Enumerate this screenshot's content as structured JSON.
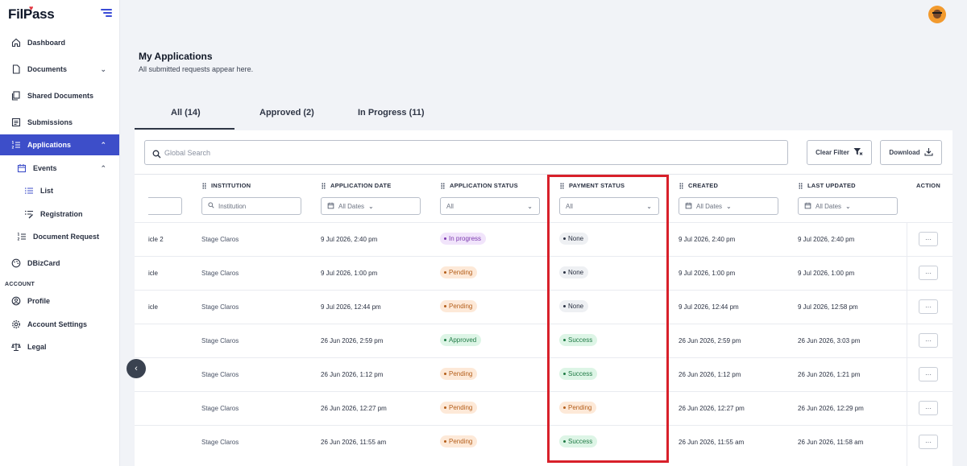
{
  "app": {
    "logo": "FilPass"
  },
  "sidebar": {
    "items": [
      {
        "label": "Dashboard",
        "icon": "home-icon"
      },
      {
        "label": "Documents",
        "icon": "document-icon"
      },
      {
        "label": "Shared Documents",
        "icon": "shared-documents-icon"
      },
      {
        "label": "Submissions",
        "icon": "submissions-icon"
      },
      {
        "label": "Applications",
        "icon": "list-numbered-icon",
        "active": true
      },
      {
        "label": "Events",
        "icon": "calendar-icon"
      },
      {
        "label": "List",
        "icon": "list-icon"
      },
      {
        "label": "Registration",
        "icon": "registration-icon"
      },
      {
        "label": "Document Request",
        "icon": "list-numbered-icon"
      },
      {
        "label": "DBizCard",
        "icon": "palette-icon"
      },
      {
        "label": "Profile",
        "icon": "user-circle-icon"
      },
      {
        "label": "Account Settings",
        "icon": "gear-icon"
      },
      {
        "label": "Legal",
        "icon": "scale-icon"
      }
    ],
    "section_account": "ACCOUNT"
  },
  "header": {
    "title": "My Applications",
    "subtitle": "All submitted requests appear here."
  },
  "tabs": [
    {
      "label": "All (14)",
      "active": true
    },
    {
      "label": "Approved (2)"
    },
    {
      "label": "In Progress (11)"
    }
  ],
  "toolbar": {
    "search_placeholder": "Global Search",
    "clear_filter": "Clear Filter",
    "download": "Download"
  },
  "table": {
    "columns": {
      "institution": "INSTITUTION",
      "application_date": "APPLICATION DATE",
      "application_status": "APPLICATION STATUS",
      "payment_status": "PAYMENT STATUS",
      "created": "CREATED",
      "last_updated": "LAST UPDATED",
      "action": "ACTION"
    },
    "filters": {
      "institution_placeholder": "Institution",
      "application_date": "All Dates",
      "application_status": "All",
      "payment_status": "All",
      "created": "All Dates",
      "last_updated": "All Dates"
    },
    "rows": [
      {
        "name": "icle 2",
        "institution": "Stage Claros",
        "application_date": "9 Jul 2026, 2:40 pm",
        "application_status": "In progress",
        "payment_status": "None",
        "created": "9 Jul 2026, 2:40 pm",
        "last_updated": "9 Jul 2026, 2:40 pm",
        "action": "···"
      },
      {
        "name": "icle",
        "institution": "Stage Claros",
        "application_date": "9 Jul 2026, 1:00 pm",
        "application_status": "Pending",
        "payment_status": "None",
        "created": "9 Jul 2026, 1:00 pm",
        "last_updated": "9 Jul 2026, 1:00 pm",
        "action": "···"
      },
      {
        "name": "icle",
        "institution": "Stage Claros",
        "application_date": "9 Jul 2026, 12:44 pm",
        "application_status": "Pending",
        "payment_status": "None",
        "created": "9 Jul 2026, 12:44 pm",
        "last_updated": "9 Jul 2026, 12:58 pm",
        "action": "···"
      },
      {
        "name": "",
        "institution": "Stage Claros",
        "application_date": "26 Jun 2026, 2:59 pm",
        "application_status": "Approved",
        "payment_status": "Success",
        "created": "26 Jun 2026, 2:59 pm",
        "last_updated": "26 Jun 2026, 3:03 pm",
        "action": "···"
      },
      {
        "name": "",
        "institution": "Stage Claros",
        "application_date": "26 Jun 2026, 1:12 pm",
        "application_status": "Pending",
        "payment_status": "Success",
        "created": "26 Jun 2026, 1:12 pm",
        "last_updated": "26 Jun 2026, 1:21 pm",
        "action": "···"
      },
      {
        "name": "",
        "institution": "Stage Claros",
        "application_date": "26 Jun 2026, 12:27 pm",
        "application_status": "Pending",
        "payment_status": "Pending",
        "created": "26 Jun 2026, 12:27 pm",
        "last_updated": "26 Jun 2026, 12:29 pm",
        "action": "···"
      },
      {
        "name": "",
        "institution": "Stage Claros",
        "application_date": "26 Jun 2026, 11:55 am",
        "application_status": "Pending",
        "payment_status": "Success",
        "created": "26 Jun 2026, 11:55 am",
        "last_updated": "26 Jun 2026, 11:58 am",
        "action": "···"
      }
    ]
  },
  "colors": {
    "accent": "#3d4ec9",
    "highlight_box": "#d8202a"
  }
}
